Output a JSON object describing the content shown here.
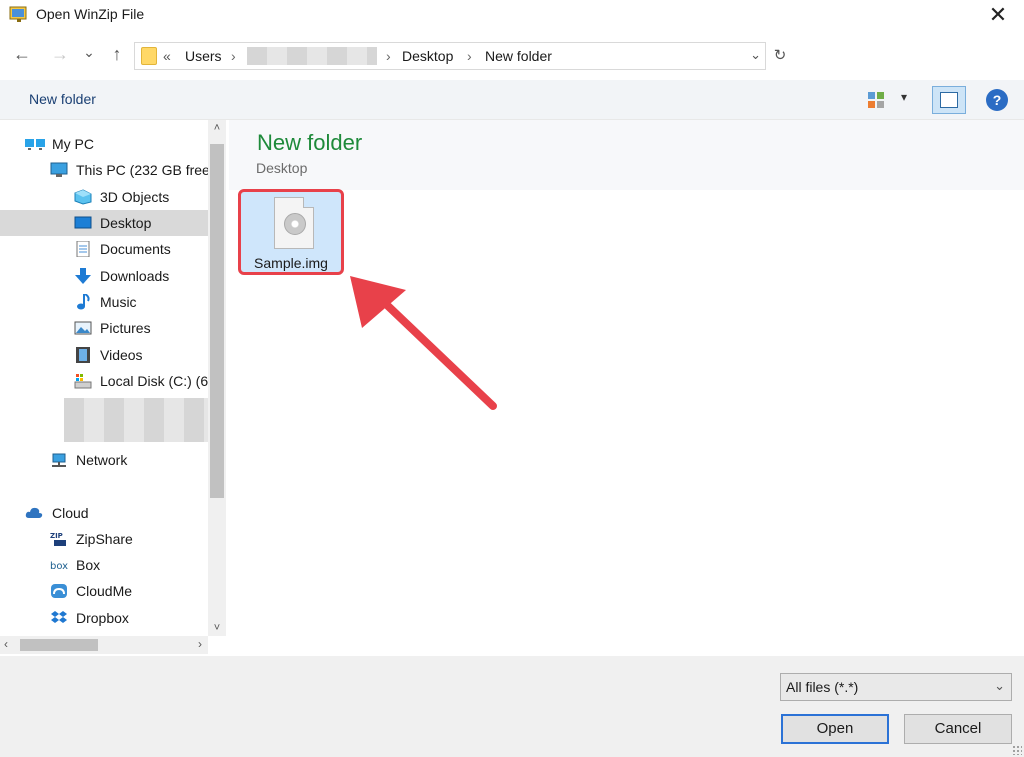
{
  "window": {
    "title": "Open WinZip File",
    "close_glyph": "✕"
  },
  "nav": {
    "back_glyph": "←",
    "forward_glyph": "→",
    "recent_glyph": "⌄",
    "up_glyph": "↑"
  },
  "address": {
    "overflow_glyph": "«",
    "crumbs": [
      "Users",
      "Desktop",
      "New folder"
    ],
    "separator": "›",
    "dropdown_glyph": "⌄",
    "refresh_glyph": "↻"
  },
  "toolbar": {
    "new_folder_label": "New folder",
    "view_dropdown_glyph": "▾",
    "help_glyph": "?"
  },
  "sidebar": {
    "items": [
      {
        "label": "My PC",
        "icon": "monitor-pair-icon",
        "selected": false
      },
      {
        "label": "This PC (232 GB free",
        "icon": "computer-icon",
        "selected": false
      },
      {
        "label": "3D Objects",
        "icon": "cube-icon",
        "selected": false
      },
      {
        "label": "Desktop",
        "icon": "desktop-icon",
        "selected": true
      },
      {
        "label": "Documents",
        "icon": "document-icon",
        "selected": false
      },
      {
        "label": "Downloads",
        "icon": "download-arrow-icon",
        "selected": false
      },
      {
        "label": "Music",
        "icon": "music-note-icon",
        "selected": false
      },
      {
        "label": "Pictures",
        "icon": "picture-icon",
        "selected": false
      },
      {
        "label": "Videos",
        "icon": "film-icon",
        "selected": false
      },
      {
        "label": "Local Disk (C:) (6",
        "icon": "drive-icon",
        "selected": false
      },
      {
        "label": "Network",
        "icon": "network-icon",
        "selected": false
      },
      {
        "label": "Cloud",
        "icon": "cloud-icon",
        "selected": false
      },
      {
        "label": "ZipShare",
        "icon": "zipshare-icon",
        "selected": false
      },
      {
        "label": "Box",
        "icon": "box-logo-icon",
        "selected": false
      },
      {
        "label": "CloudMe",
        "icon": "cloudme-icon",
        "selected": false
      },
      {
        "label": "Dropbox",
        "icon": "dropbox-icon",
        "selected": false
      }
    ],
    "scroll_up_glyph": "˄",
    "scroll_down_glyph": "˅",
    "scroll_left_glyph": "‹",
    "scroll_right_glyph": "›"
  },
  "content": {
    "group_title": "New folder",
    "group_subtitle": "Desktop",
    "files": [
      {
        "name": "Sample.img",
        "icon": "disc-image-icon",
        "selected": true
      }
    ],
    "annotation_color": "#e8414a"
  },
  "footer": {
    "file_type_filter": "All files (*.*)",
    "filter_chevron": "⌄",
    "open_label": "Open",
    "cancel_label": "Cancel"
  },
  "colors": {
    "group_title": "#1e8a3a",
    "selection": "#cfe6fb",
    "accent": "#2b72d6"
  }
}
